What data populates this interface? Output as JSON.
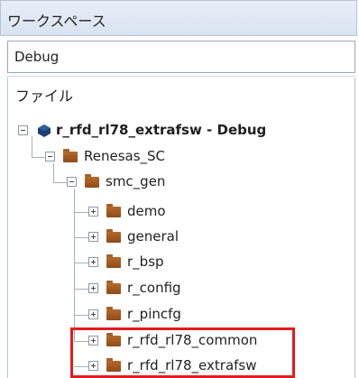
{
  "panel": {
    "title": "ワークスペース",
    "configuration": "Debug",
    "file_header": "ファイル"
  },
  "tree": {
    "project": {
      "label": "r_rfd_rl78_extrafsw - Debug",
      "expanded": true,
      "icon": "project-cube-icon"
    },
    "items": [
      {
        "label": "Renesas_SC",
        "level": 1,
        "expanded": true,
        "icon": "folder-icon"
      },
      {
        "label": "smc_gen",
        "level": 2,
        "expanded": true,
        "icon": "folder-icon"
      },
      {
        "label": "demo",
        "level": 3,
        "expanded": false,
        "icon": "folder-icon"
      },
      {
        "label": "general",
        "level": 3,
        "expanded": false,
        "icon": "folder-icon"
      },
      {
        "label": "r_bsp",
        "level": 3,
        "expanded": false,
        "icon": "folder-icon"
      },
      {
        "label": "r_config",
        "level": 3,
        "expanded": false,
        "icon": "folder-icon"
      },
      {
        "label": "r_pincfg",
        "level": 3,
        "expanded": false,
        "icon": "folder-icon"
      },
      {
        "label": "r_rfd_rl78_common",
        "level": 3,
        "expanded": false,
        "icon": "folder-icon",
        "highlighted": true
      },
      {
        "label": "r_rfd_rl78_extrafsw",
        "level": 3,
        "expanded": false,
        "icon": "folder-icon",
        "highlighted": true
      }
    ]
  },
  "colors": {
    "highlight_border": "#e31b1b",
    "folder": "#9b5522",
    "project_icon": "#1b3f73"
  }
}
